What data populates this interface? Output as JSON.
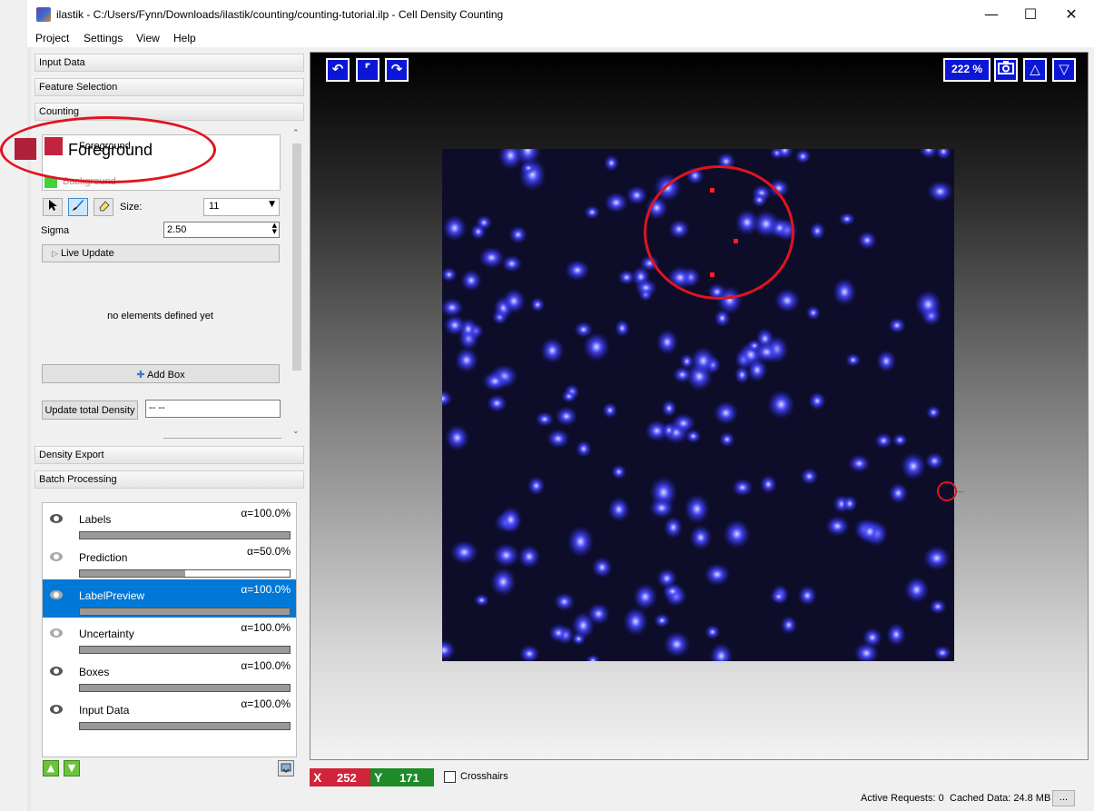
{
  "window": {
    "title": "ilastik - C:/Users/Fynn/Downloads/ilastik/counting/counting-tutorial.ilp - Cell Density Counting",
    "minimize": "—",
    "maximize": "☐",
    "close": "✕"
  },
  "menu": [
    "Project",
    "Settings",
    "View",
    "Help"
  ],
  "applets": {
    "input_data": "Input Data",
    "feature_selection": "Feature Selection",
    "counting": "Counting",
    "density_export": "Density Export",
    "batch_processing": "Batch Processing"
  },
  "counting": {
    "labels": [
      {
        "name": "Foreground",
        "color": "#c2243f"
      },
      {
        "name": "Background",
        "color": "#3fd23f"
      }
    ],
    "size_label": "Size:",
    "size_value": "11",
    "sigma_label": "Sigma",
    "sigma_value": "2.50",
    "live_update": "Live Update",
    "no_elements": "no elements defined yet",
    "add_box": "Add Box",
    "update_density": "Update total Density",
    "density_value": "-- --"
  },
  "layers": [
    {
      "name": "Labels",
      "alpha": "α=100.0%",
      "opacity": 1.0,
      "eye": "visible",
      "selected": false
    },
    {
      "name": "Prediction",
      "alpha": "α=50.0%",
      "opacity": 0.5,
      "eye": "hidden",
      "selected": false
    },
    {
      "name": "LabelPreview",
      "alpha": "α=100.0%",
      "opacity": 1.0,
      "eye": "hidden",
      "selected": true
    },
    {
      "name": "Uncertainty",
      "alpha": "α=100.0%",
      "opacity": 1.0,
      "eye": "hidden",
      "selected": false
    },
    {
      "name": "Boxes",
      "alpha": "α=100.0%",
      "opacity": 1.0,
      "eye": "visible",
      "selected": false
    },
    {
      "name": "Input Data",
      "alpha": "α=100.0%",
      "opacity": 1.0,
      "eye": "visible",
      "selected": false
    }
  ],
  "viewer": {
    "zoom": "222 %",
    "colors": {
      "button": "#0b16d6",
      "annotation": "#e0141e"
    }
  },
  "status": {
    "x_label": "X",
    "x_value": "252",
    "y_label": "Y",
    "y_value": "171",
    "crosshairs": "Crosshairs",
    "active_requests": "Active Requests: 0",
    "cached_data": "Cached Data: 24.8 MB",
    "more": "..."
  }
}
